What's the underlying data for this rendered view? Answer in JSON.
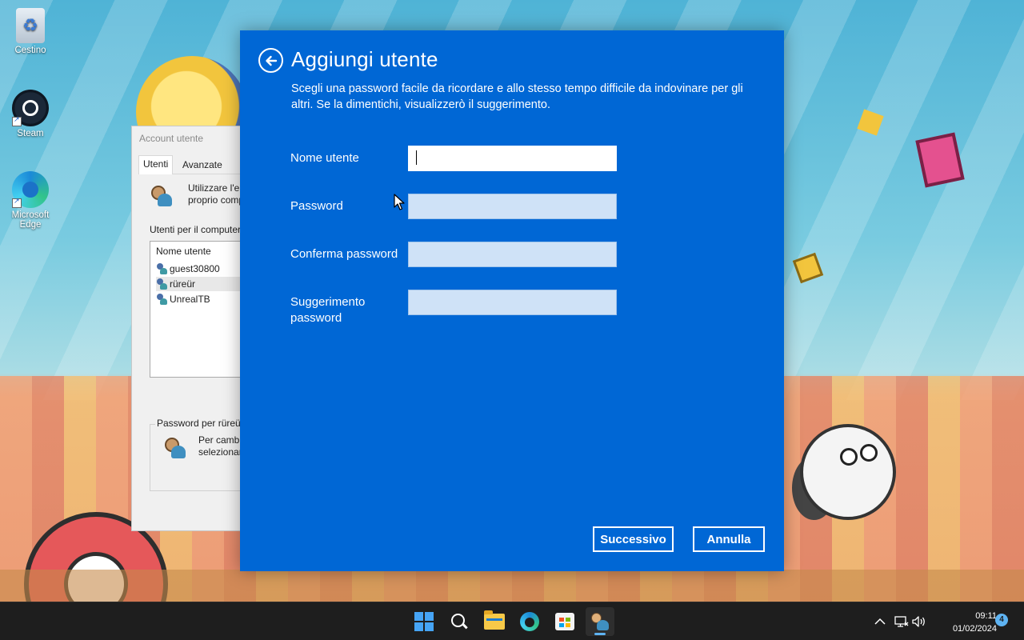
{
  "desktop": {
    "icons": [
      {
        "label": "Cestino"
      },
      {
        "label": "Steam"
      },
      {
        "label": "Microsoft Edge"
      }
    ]
  },
  "background_window": {
    "title": "Account utente",
    "tabs": [
      "Utenti",
      "Avanzate"
    ],
    "description_line1": "Utilizzare l'el",
    "description_line2": "proprio comp",
    "users_label": "Utenti per il computer",
    "list_header": "Nome utente",
    "users": [
      "guest30800",
      "rüreür",
      "UnrealTB"
    ],
    "password_group_label": "Password per rüreür",
    "password_text_line1": "Per cambi",
    "password_text_line2": "selezionar"
  },
  "dialog": {
    "title": "Aggiungi utente",
    "description": "Scegli una password facile da ricordare e allo stesso tempo difficile da indovinare per gli altri. Se la dimentichi, visualizzerò il suggerimento.",
    "fields": [
      {
        "label": "Nome utente",
        "value": ""
      },
      {
        "label": "Password",
        "value": ""
      },
      {
        "label": "Conferma password",
        "value": ""
      },
      {
        "label_line1": "Suggerimento",
        "label_line2": "password",
        "value": ""
      }
    ],
    "next_button": "Successivo",
    "cancel_button": "Annulla",
    "background_color": "#0067d5"
  },
  "taskbar": {
    "apps": [
      "start-icon",
      "search-icon",
      "file-explorer-icon",
      "edge-icon",
      "microsoft-store-icon",
      "user-accounts-icon"
    ],
    "active_app": "user-accounts-icon",
    "time": "09:11",
    "date": "01/02/2024",
    "notification_count": "4"
  }
}
